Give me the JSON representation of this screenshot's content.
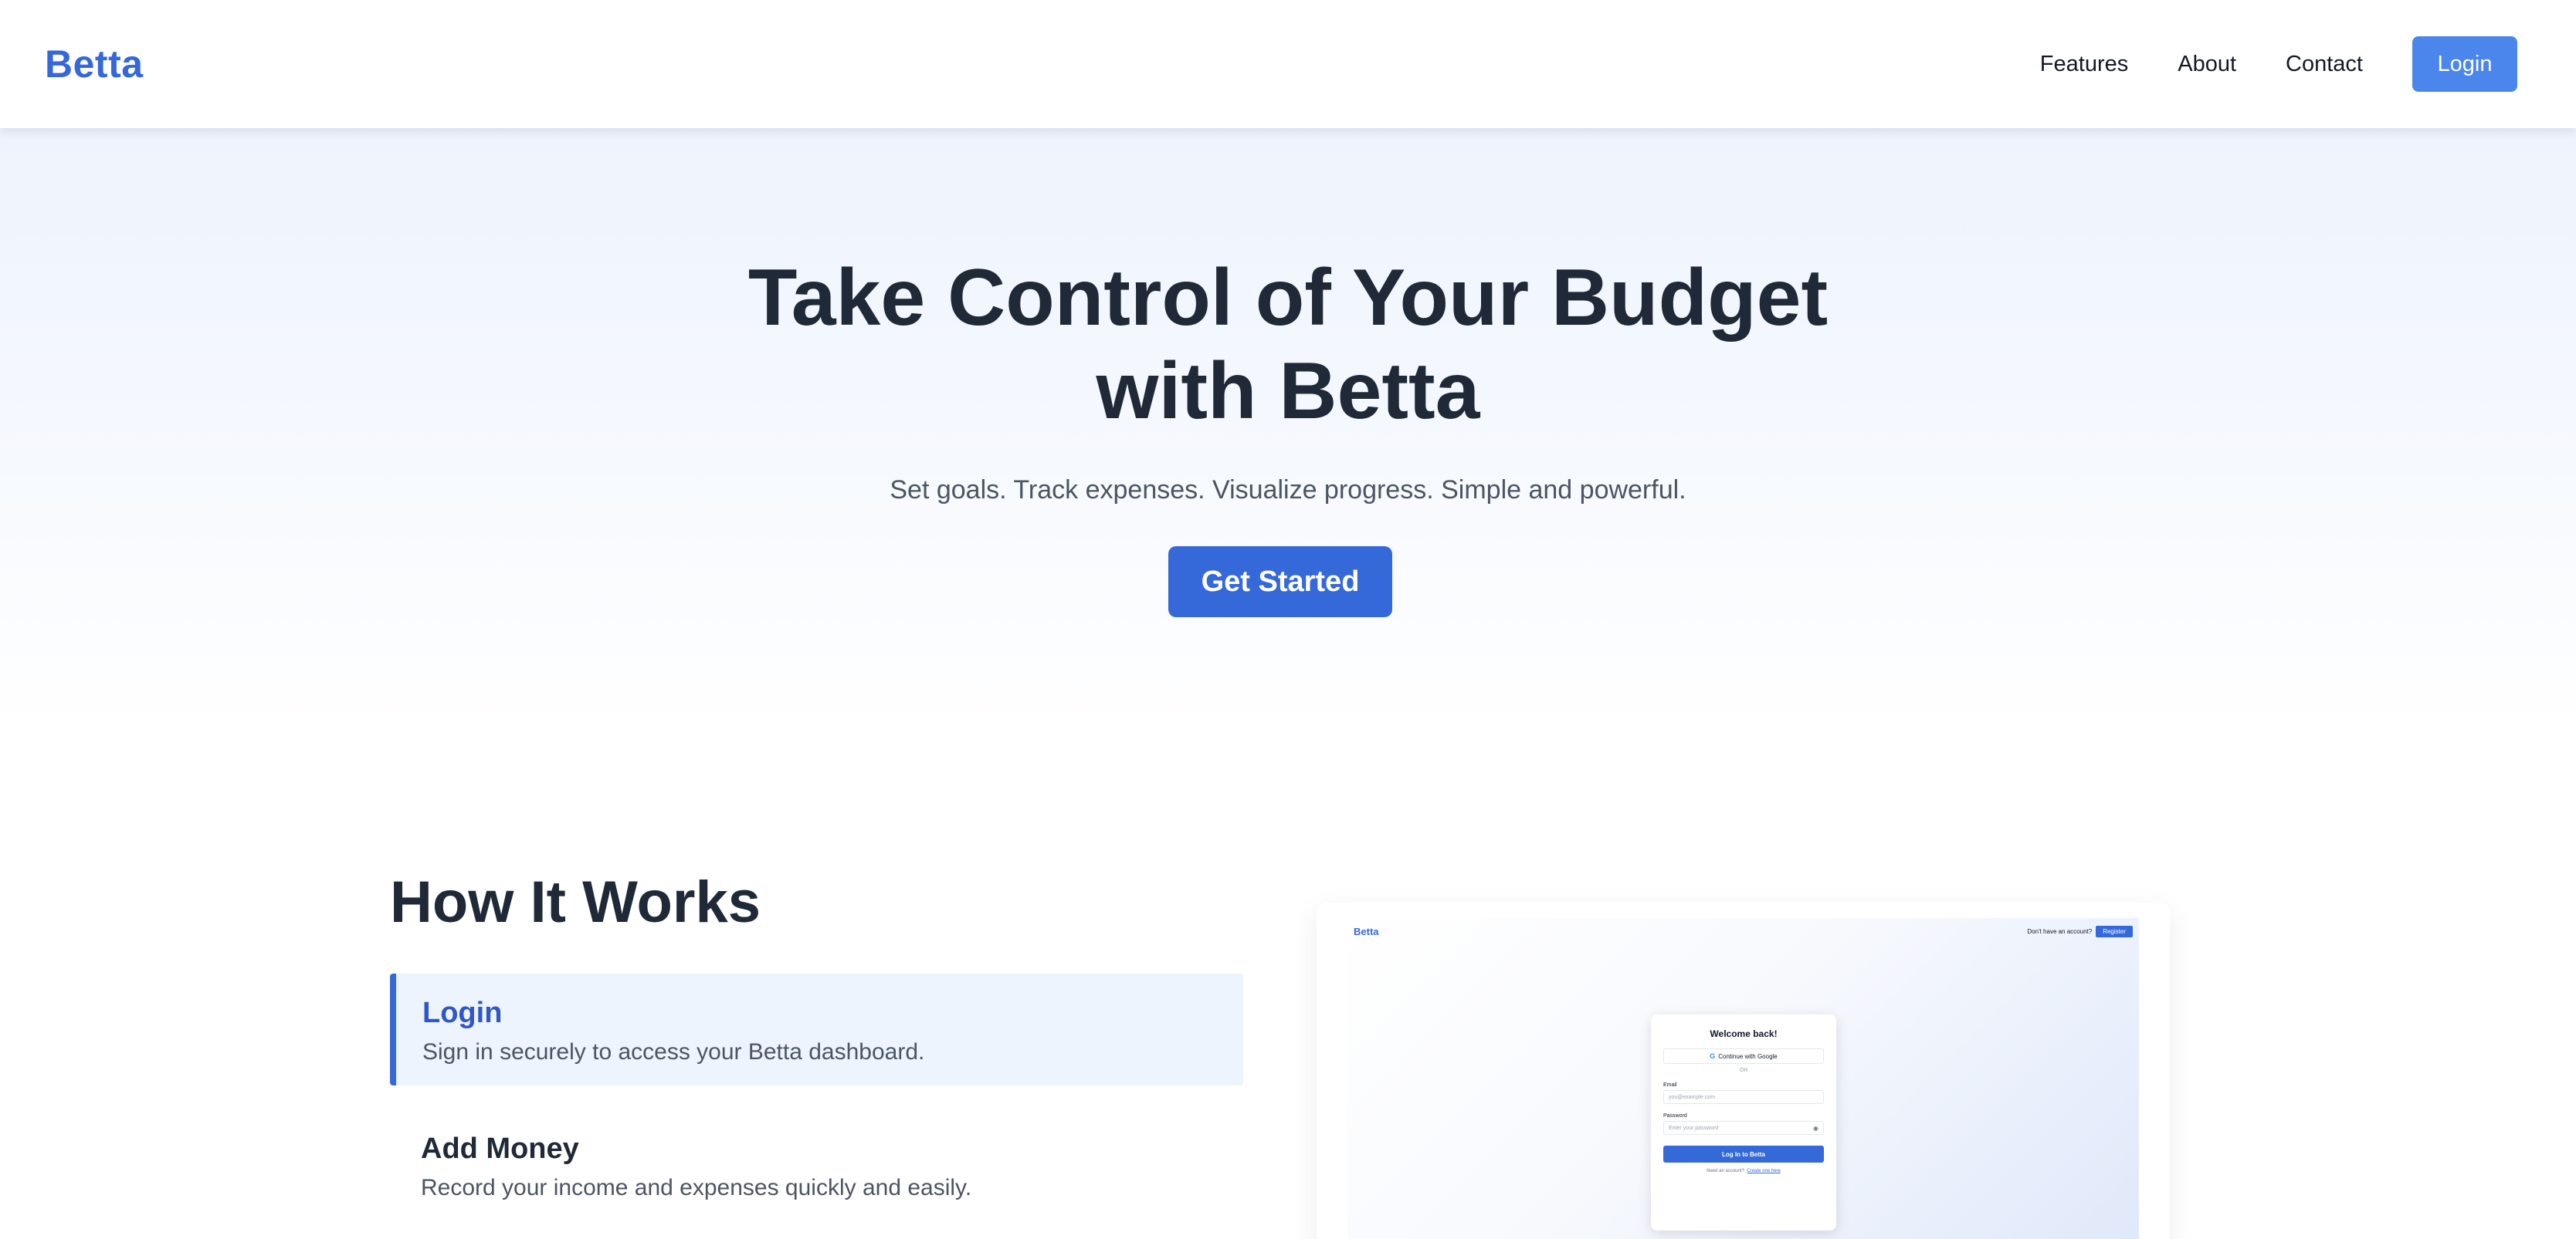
{
  "header": {
    "brand": "Betta",
    "nav": [
      "Features",
      "About",
      "Contact"
    ],
    "login_label": "Login"
  },
  "hero": {
    "title": "Take Control of Your Budget with Betta",
    "subtitle": "Set goals. Track expenses. Visualize progress. Simple and powerful.",
    "cta_label": "Get Started"
  },
  "how_it_works": {
    "title": "How It Works",
    "steps": [
      {
        "title": "Login",
        "description": "Sign in securely to access your Betta dashboard.",
        "active": true
      },
      {
        "title": "Add Money",
        "description": "Record your income and expenses quickly and easily.",
        "active": false
      }
    ]
  },
  "preview": {
    "brand": "Betta",
    "no_account_text": "Don't have an account?",
    "register_label": "Register",
    "modal": {
      "title": "Welcome back!",
      "google_label": "Continue with Google",
      "divider": "OR",
      "email_label": "Email",
      "email_placeholder": "you@example.com",
      "password_label": "Password",
      "password_placeholder": "Enter your password",
      "submit_label": "Log In to Betta",
      "footer_text": "Need an account?",
      "footer_link": "Create one here"
    }
  },
  "colors": {
    "brand": "#3568d8",
    "login_button": "#4a86ec",
    "heading": "#1f2937",
    "body_text": "#4b5563",
    "active_step_bg": "#eef4fd"
  }
}
